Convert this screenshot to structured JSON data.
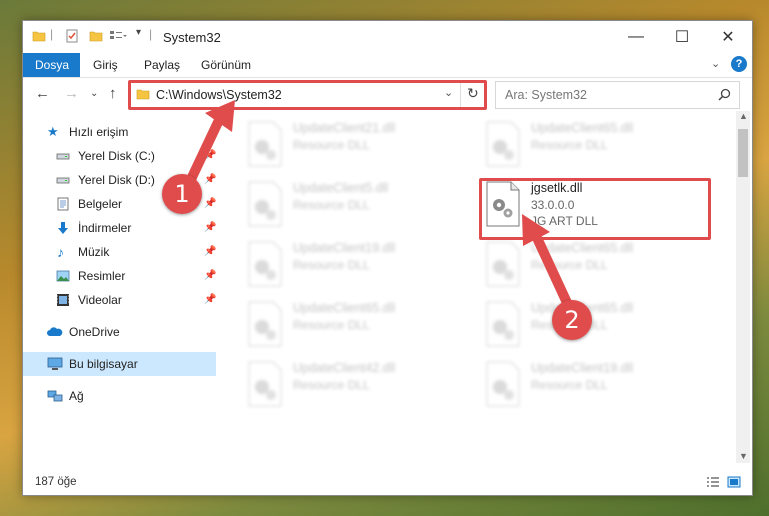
{
  "window": {
    "title": "System32"
  },
  "ribbon": {
    "tabs": [
      "Dosya",
      "Giriş",
      "Paylaş",
      "Görünüm"
    ]
  },
  "address": {
    "path": "C:\\Windows\\System32"
  },
  "search": {
    "placeholder": "Ara: System32"
  },
  "sidebar": {
    "items": [
      {
        "label": "Hızlı erişim",
        "icon": "star-icon"
      },
      {
        "label": "Yerel Disk (C:)",
        "icon": "disk-icon"
      },
      {
        "label": "Yerel Disk (D:)",
        "icon": "disk-icon"
      },
      {
        "label": "Belgeler",
        "icon": "document-icon"
      },
      {
        "label": "İndirmeler",
        "icon": "download-icon"
      },
      {
        "label": "Müzik",
        "icon": "music-icon"
      },
      {
        "label": "Resimler",
        "icon": "pictures-icon"
      },
      {
        "label": "Videolar",
        "icon": "video-icon"
      },
      {
        "label": "OneDrive",
        "icon": "cloud-icon"
      },
      {
        "label": "Bu bilgisayar",
        "icon": "computer-icon"
      },
      {
        "label": "Ağ",
        "icon": "network-icon"
      }
    ]
  },
  "files": [
    {
      "name": "UpdateClient21.dll",
      "desc": "Resource DLL"
    },
    {
      "name": "UpdateClient65.dll",
      "desc": "Resource DLL"
    },
    {
      "name": "UpdateClient5.dll",
      "desc": "Resource DLL"
    },
    {
      "name": "jgsetlk.dll",
      "version": "33.0.0.0",
      "desc": "JG ART DLL"
    },
    {
      "name": "UpdateClient19.dll",
      "desc": "Resource DLL"
    },
    {
      "name": "UpdateClient65.dll",
      "desc": "Resource DLL"
    },
    {
      "name": "UpdateClient65.dll",
      "desc": "Resource DLL"
    },
    {
      "name": "UpdateClient65.dll",
      "desc": "Resource DLL"
    },
    {
      "name": "UpdateClient42.dll",
      "desc": "Resource DLL"
    },
    {
      "name": "UpdateClient19.dll",
      "desc": "Resource DLL"
    }
  ],
  "status": {
    "count": "187 öğe"
  },
  "markers": [
    "1",
    "2"
  ],
  "colors": {
    "accent": "#1979ca",
    "highlight": "#e04b4b",
    "selected": "#cce8ff"
  }
}
